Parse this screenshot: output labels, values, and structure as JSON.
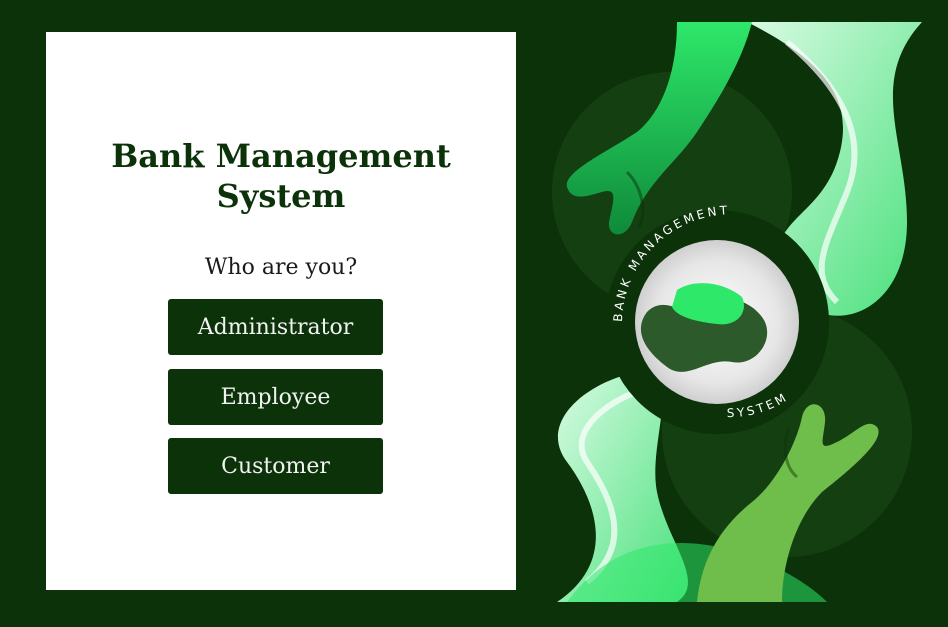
{
  "app": {
    "title": "Bank Management System",
    "prompt": "Who are you?"
  },
  "roles": [
    {
      "label": "Administrator"
    },
    {
      "label": "Employee"
    },
    {
      "label": "Customer"
    }
  ],
  "illustration": {
    "ring_text_top": "BANK MANAGEMENT",
    "ring_text_bottom": "SYSTEM"
  },
  "colors": {
    "background": "#0b3208",
    "panel": "#ffffff",
    "button": "#0b3208",
    "accent_green": "#2ee86a",
    "light_green": "#b6f5c9"
  },
  "icons": [
    "hand-top-icon",
    "hand-bottom-icon",
    "globe-icon"
  ]
}
